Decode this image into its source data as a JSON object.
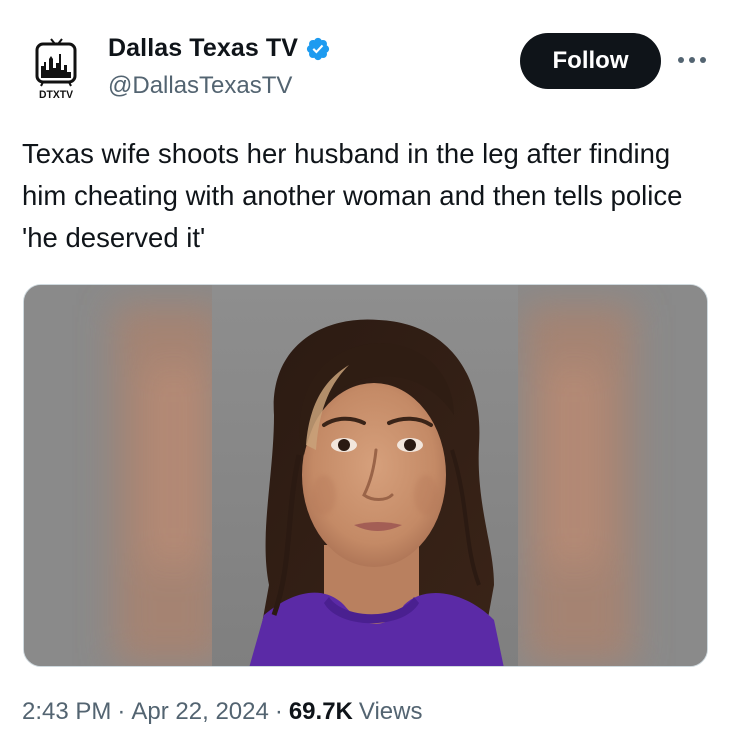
{
  "author": {
    "display_name": "Dallas Texas TV",
    "handle": "@DallasTexasTV",
    "avatar_logo_text": "DTXTV",
    "verified": true,
    "verified_color": "#1d9bf0"
  },
  "actions": {
    "follow_label": "Follow",
    "more_icon": "more-horizontal-icon"
  },
  "tweet": {
    "text": "Texas wife shoots her husband in the leg after finding him cheating with another woman and then tells police 'he deserved it'"
  },
  "meta": {
    "time": "2:43 PM",
    "separator": "·",
    "date": "Apr 22, 2024",
    "views_count": "69.7K",
    "views_label": "Views"
  },
  "colors": {
    "text_primary": "#0f1419",
    "text_secondary": "#536471",
    "button_bg": "#0f1419",
    "shirt_purple": "#5b2aa6"
  }
}
